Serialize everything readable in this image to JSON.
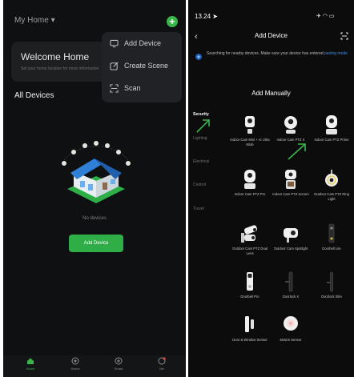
{
  "left": {
    "home_label": "My Home",
    "plus_symbol": "+",
    "welcome_title": "Welcome Home",
    "welcome_subtitle": "Set your home location for more information",
    "all_devices": "All Devices",
    "menu": [
      {
        "label": "Add Device",
        "icon": "add-device-icon"
      },
      {
        "label": "Create Scene",
        "icon": "create-scene-icon"
      },
      {
        "label": "Scan",
        "icon": "scan-icon"
      }
    ],
    "empty_text": "No devices",
    "add_device_button": "Add Device",
    "tabs": [
      {
        "label": "Home",
        "icon": "home-icon",
        "active": true
      },
      {
        "label": "Scene",
        "icon": "scene-icon",
        "active": false
      },
      {
        "label": "Smart",
        "icon": "smart-icon",
        "active": false
      },
      {
        "label": "Me",
        "icon": "me-icon",
        "active": false
      }
    ],
    "accent_color": "#39b54a"
  },
  "right": {
    "status_time": "13.24",
    "title": "Add Device",
    "search_message": "Searching for nearby devices. Make sure your device has entered",
    "search_link": "pairing mode",
    "section_title": "Add Manually",
    "categories": [
      "Security",
      "Lighting",
      "Electrical",
      "Control",
      "Travel"
    ],
    "active_category": "Security",
    "devices": [
      {
        "name": "Indoor Cam Mini + AI Ultra Wide",
        "icon": "mini-cam-icon"
      },
      {
        "name": "Indoor Cam PTZ X",
        "icon": "dome-cam-icon"
      },
      {
        "name": "Indoor Cam PTZ Prime",
        "icon": "ptz-cam-icon"
      },
      {
        "name": "Indoor Cam PTZ Pro",
        "icon": "ptz-cam-icon"
      },
      {
        "name": "Indoor Cam PTZ Screen",
        "icon": "screen-cam-icon"
      },
      {
        "name": "Outdoor Cam PTZ Ring Light",
        "icon": "ring-light-cam-icon"
      },
      {
        "name": "Outdoor Cam PTZ Dual Lens",
        "icon": "dual-lens-cam-icon"
      },
      {
        "name": "Outdoor Cam Spotlight",
        "icon": "spotlight-cam-icon"
      },
      {
        "name": "Doorbell Lite",
        "icon": "doorbell-icon"
      },
      {
        "name": "Doorbell Pro",
        "icon": "doorbell-icon"
      },
      {
        "name": "Doorlock X",
        "icon": "doorlock-icon"
      },
      {
        "name": "Doorlock Slim",
        "icon": "doorlock-icon"
      },
      {
        "name": "Door & Window Sensor",
        "icon": "door-sensor-icon"
      },
      {
        "name": "Motion Sensor",
        "icon": "motion-sensor-icon"
      }
    ],
    "link_color": "#3b8ef0",
    "arrow_color": "#39b54a"
  }
}
